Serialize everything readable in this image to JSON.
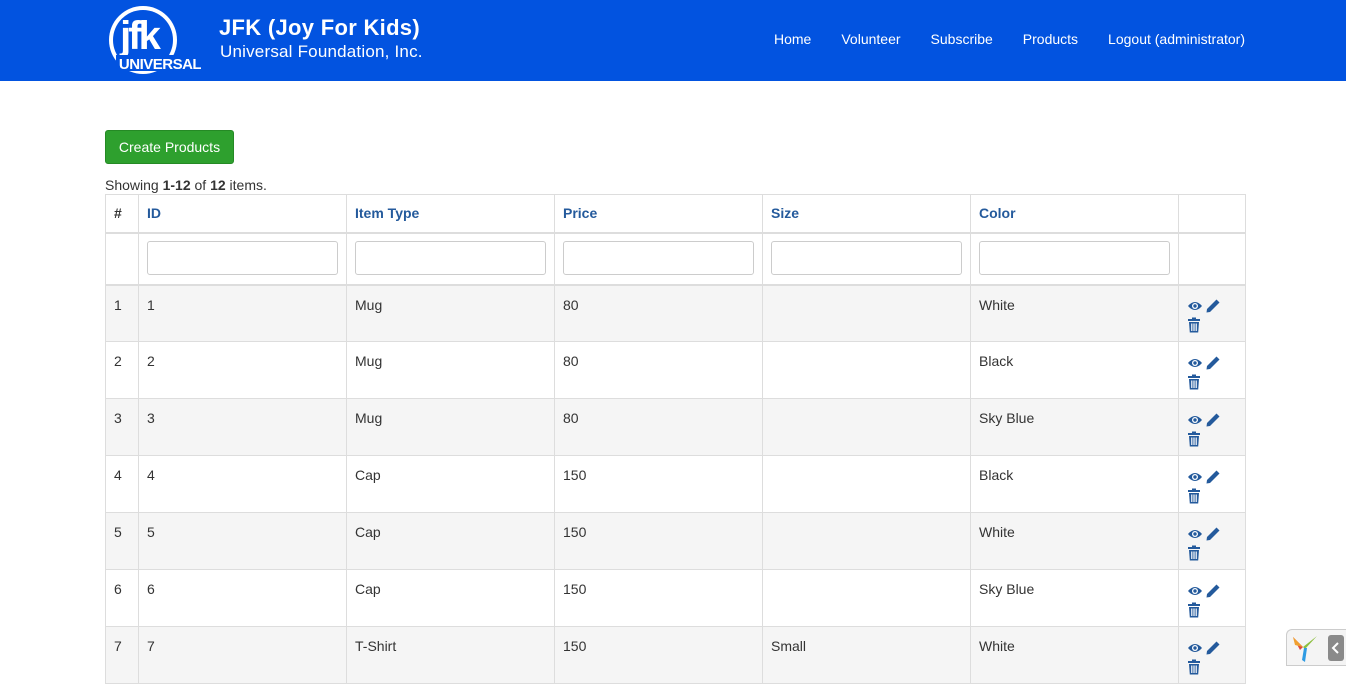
{
  "brand": {
    "logo_text_top": "jfk",
    "logo_text_bottom": "UNIVERSAL",
    "title": "JFK (Joy For Kids)",
    "subtitle": "Universal Foundation, Inc."
  },
  "nav": {
    "items": [
      "Home",
      "Volunteer",
      "Subscribe",
      "Products",
      "Logout (administrator)"
    ]
  },
  "create_button": "Create Products",
  "summary": {
    "prefix": "Showing ",
    "range": "1-12",
    "mid": " of ",
    "total": "12",
    "suffix": " items."
  },
  "table": {
    "headers": [
      "#",
      "ID",
      "Item Type",
      "Price",
      "Size",
      "Color",
      ""
    ],
    "rows": [
      [
        "1",
        "1",
        "Mug",
        "80",
        "",
        "White"
      ],
      [
        "2",
        "2",
        "Mug",
        "80",
        "",
        "Black"
      ],
      [
        "3",
        "3",
        "Mug",
        "80",
        "",
        "Sky Blue"
      ],
      [
        "4",
        "4",
        "Cap",
        "150",
        "",
        "Black"
      ],
      [
        "5",
        "5",
        "Cap",
        "150",
        "",
        "White"
      ],
      [
        "6",
        "6",
        "Cap",
        "150",
        "",
        "Sky Blue"
      ],
      [
        "7",
        "7",
        "T-Shirt",
        "150",
        "Small",
        "White"
      ]
    ],
    "action_icons": [
      "eye-icon",
      "pencil-icon",
      "trash-icon"
    ]
  },
  "colors": {
    "navbar": "#0253e0",
    "button": "#2ea02e",
    "link": "#245a9c"
  }
}
